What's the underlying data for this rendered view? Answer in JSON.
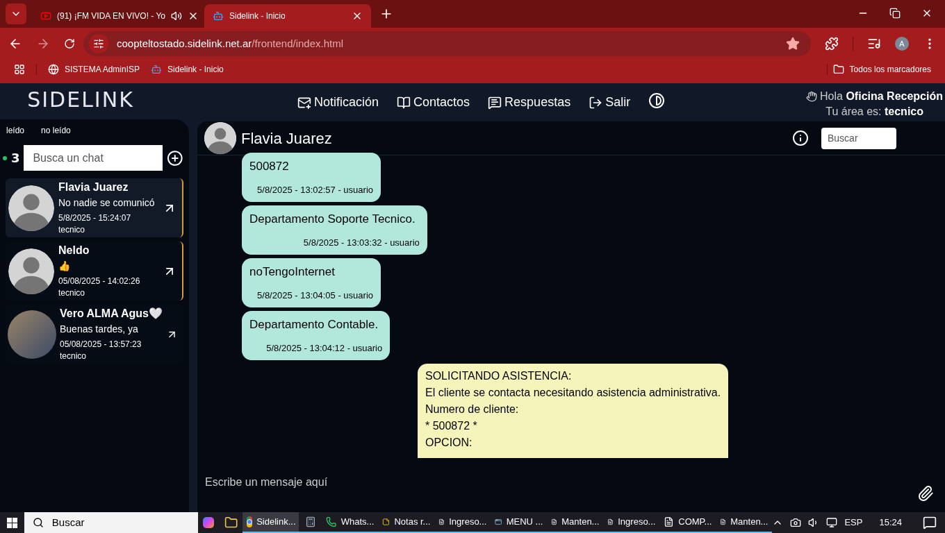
{
  "browser": {
    "tabs": [
      {
        "title": "(91) ¡FM VIDA EN VIVO! - Yo",
        "kind": "video",
        "audio": true,
        "selected": false
      },
      {
        "title": "Sidelink - Inicio",
        "kind": "app",
        "audio": false,
        "selected": true
      }
    ],
    "url_host": "coopteltostado.sidelink.net.ar",
    "url_path": "/frontend/index.html",
    "avatar": "A",
    "bookmarks": [
      {
        "label": "SISTEMA AdminISP",
        "kind": "globe"
      },
      {
        "label": "Sidelink - Inicio",
        "kind": "app"
      }
    ],
    "all_bookmarks": "Todos los marcadores"
  },
  "app": {
    "logo": "SIDELINK",
    "nav": [
      {
        "label": "Notificación",
        "kind": "mail"
      },
      {
        "label": "Contactos",
        "kind": "book"
      },
      {
        "label": "Respuestas",
        "kind": "replies"
      },
      {
        "label": "Salir",
        "kind": "exit"
      }
    ],
    "greeting": "Hola **Oficina Recepción**",
    "area": "Tu área es: **tecnico**"
  },
  "sidebar": {
    "filters": [
      "leído",
      "no leído"
    ],
    "count": "3",
    "search_placeholder": "Busca un chat",
    "chats": [
      {
        "name": "Flavia Juarez",
        "preview": "No nadie se comunicó",
        "time": "5/8/2025 - 15:24:07",
        "area": "tecnico",
        "photo": false,
        "pending": true,
        "selected": true
      },
      {
        "name": "Neldo",
        "preview": "👍",
        "time": "05/08/2025 - 14:02:26",
        "area": "tecnico",
        "photo": false,
        "pending": true,
        "selected": false
      },
      {
        "name": "Vero ALMA Agus🤍",
        "preview": "Buenas tardes, ya",
        "time": "05/08/2025 - 13:57:23",
        "area": "tecnico",
        "photo": true,
        "pending": false,
        "selected": false
      }
    ]
  },
  "chat": {
    "contact": "Flavia Juarez",
    "search_placeholder": "Buscar",
    "messages": [
      {
        "kind": "client",
        "lines": [
          "500872"
        ],
        "meta": "5/8/2025 - 13:02:57 - usuario"
      },
      {
        "kind": "client",
        "lines": [
          "Departamento Soporte Tecnico."
        ],
        "meta": "5/8/2025 - 13:03:32 - usuario"
      },
      {
        "kind": "client",
        "lines": [
          "noTengoInternet"
        ],
        "meta": "5/8/2025 - 13:04:05 - usuario"
      },
      {
        "kind": "client",
        "lines": [
          "Departamento Contable."
        ],
        "meta": "5/8/2025 - 13:04:12 - usuario"
      },
      {
        "kind": "system",
        "lines": [
          "SOLICITANDO ASISTENCIA:",
          "El cliente se contacta necesitando asistencia administrativa.",
          "Numero de cliente:",
          "* 500872 *",
          "OPCION:"
        ]
      }
    ],
    "compose_placeholder": "Escribe un mensaje aquí"
  },
  "taskbar": {
    "search": "Buscar",
    "apps": [
      {
        "label": "Sidelink...",
        "kind": "chrome",
        "selected": true
      },
      {
        "kind": "calc",
        "selected": false
      },
      {
        "label": "Whats...",
        "kind": "whatsapp",
        "selected": false
      },
      {
        "label": "Notas r...",
        "kind": "notes",
        "selected": false
      },
      {
        "label": "Ingreso...",
        "kind": "doc",
        "selected": false
      },
      {
        "label": "MENU ...",
        "kind": "window",
        "selected": false
      },
      {
        "label": "Manten...",
        "kind": "doc",
        "selected": false
      },
      {
        "label": "Ingreso...",
        "kind": "doc",
        "selected": false
      },
      {
        "label": "COMP...",
        "kind": "doc",
        "selected": false
      },
      {
        "label": "Manten...",
        "kind": "doc",
        "selected": false
      }
    ],
    "lang": "ESP",
    "clock": "15:24"
  }
}
